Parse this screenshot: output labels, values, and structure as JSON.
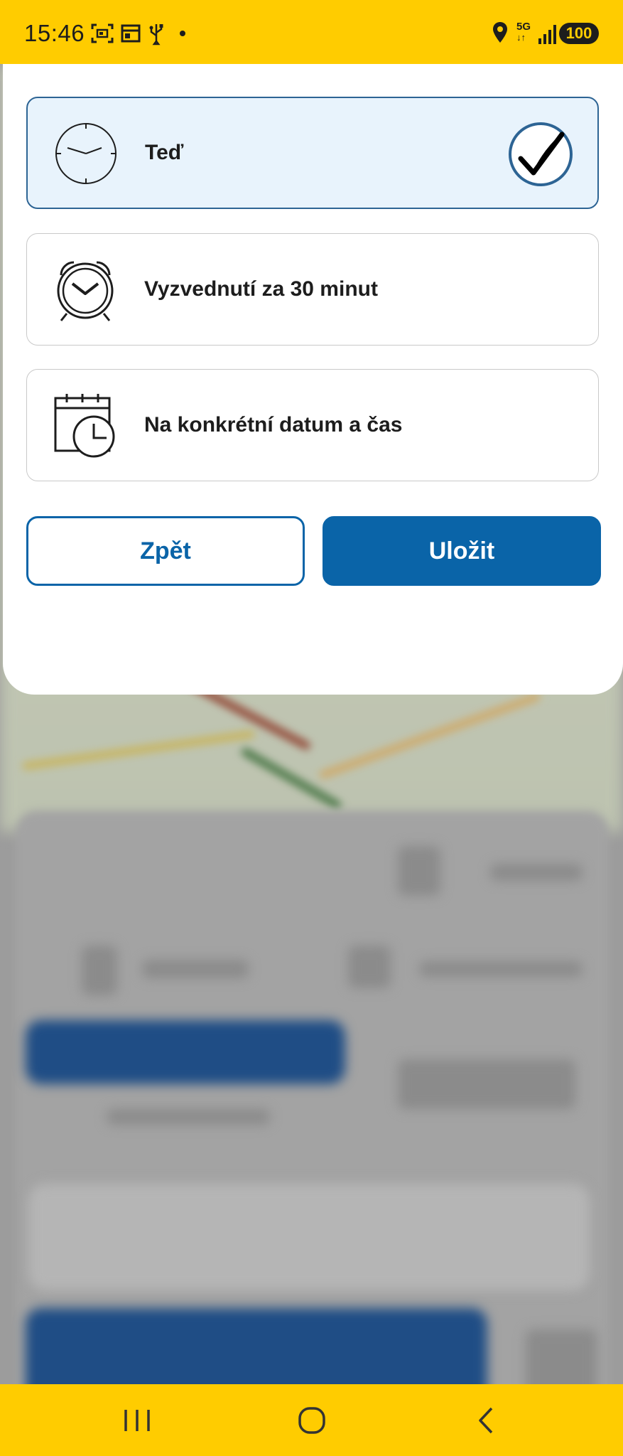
{
  "status_bar": {
    "time": "15:46",
    "network_top": "5G",
    "network_bottom": "↓↑",
    "battery": "100",
    "icons": [
      "screenshot-icon",
      "calendar-icon",
      "usb-icon",
      "dot-icon",
      "location-icon",
      "signal-icon"
    ]
  },
  "sheet": {
    "options": [
      {
        "label": "Teď",
        "icon": "clock-icon",
        "selected": true
      },
      {
        "label": "Vyzvednutí za 30 minut",
        "icon": "alarm-clock-icon",
        "selected": false
      },
      {
        "label": "Na konkrétní datum a čas",
        "icon": "calendar-clock-icon",
        "selected": false
      }
    ],
    "back_label": "Zpět",
    "save_label": "Uložit"
  },
  "nav_bar": {
    "icons": [
      "recent-apps-icon",
      "home-icon",
      "back-icon"
    ]
  },
  "colors": {
    "accent": "#0a64a8",
    "brand_yellow": "#ffcc00",
    "selected_bg": "#e8f3fc"
  }
}
